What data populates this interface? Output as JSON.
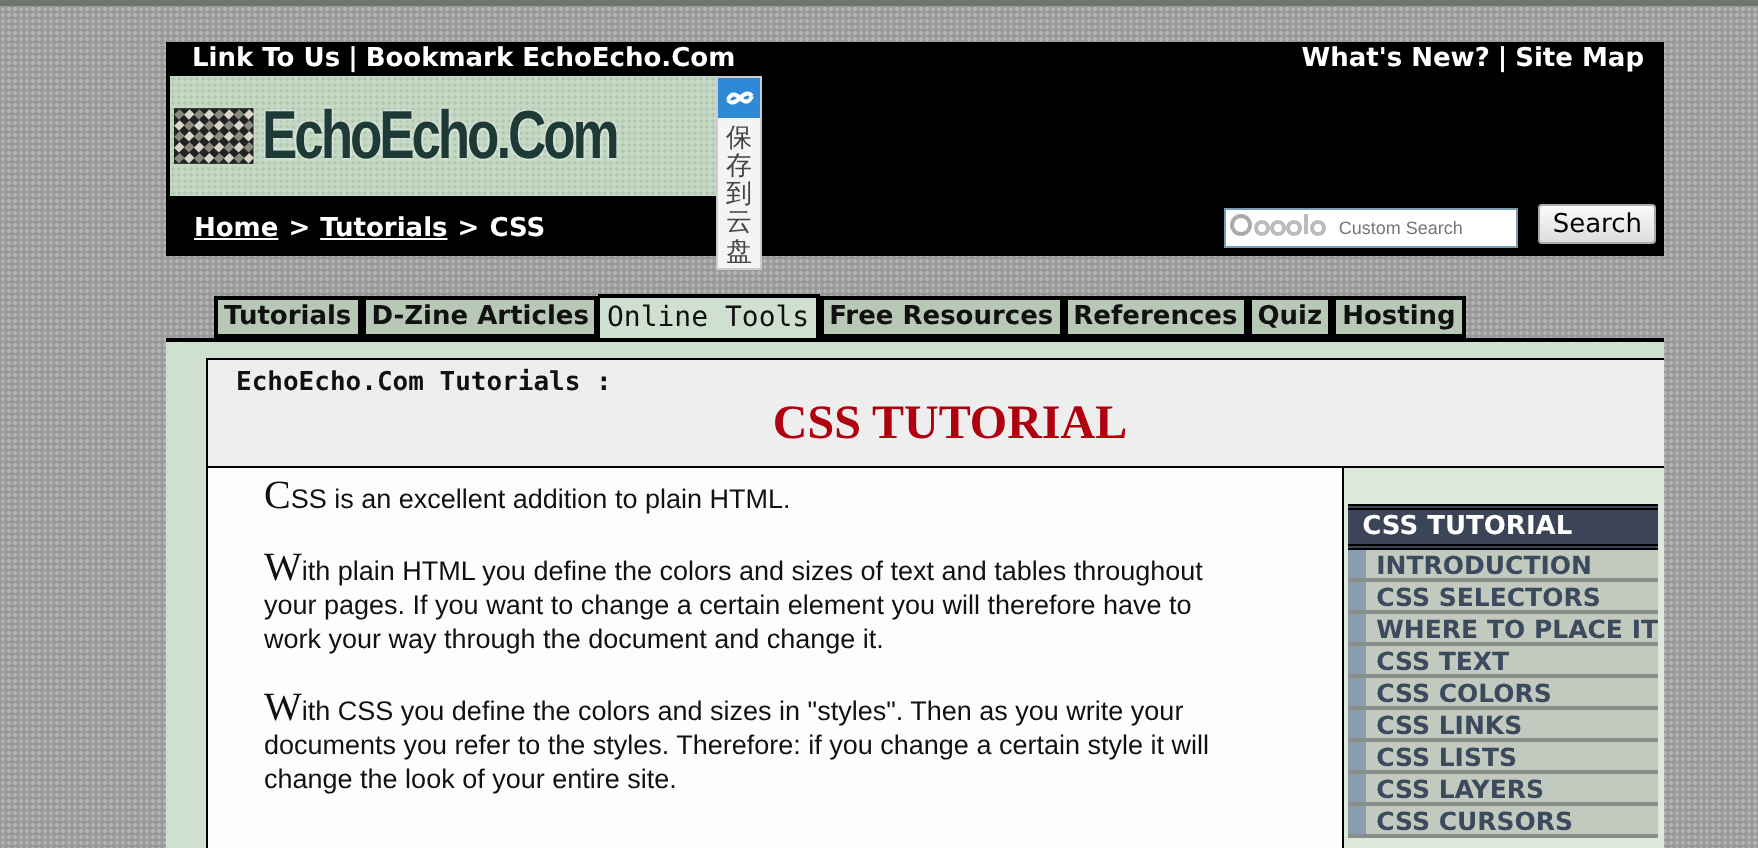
{
  "header": {
    "top_left_links": [
      "Link To Us",
      "Bookmark EchoEcho.Com"
    ],
    "link_separator": "|",
    "top_right_links": [
      "What's New?",
      "Site Map"
    ],
    "breadcrumb_separator": ">",
    "logo_text": "EchoEcho.Com",
    "cloud_save": "保存到云盘",
    "breadcrumb": [
      "Home",
      "Tutorials",
      "CSS"
    ],
    "search": {
      "placeholder": "Custom Search",
      "button": "Search"
    }
  },
  "tabs": [
    {
      "label": "Tutorials",
      "selected": false
    },
    {
      "label": "D-Zine Articles",
      "selected": false
    },
    {
      "label": "Online Tools",
      "selected": true
    },
    {
      "label": "Free Resources",
      "selected": false
    },
    {
      "label": "References",
      "selected": false
    },
    {
      "label": "Quiz",
      "selected": false
    },
    {
      "label": "Hosting",
      "selected": false
    }
  ],
  "content": {
    "subtitle": "EchoEcho.Com Tutorials :",
    "title": "CSS TUTORIAL",
    "paragraphs": [
      "CSS is an excellent addition to plain HTML.",
      "With plain HTML you define the colors and sizes of text and tables throughout your pages. If you want to change a certain element you will therefore have to work your way through the document and change it.",
      "With CSS you define the colors and sizes in \"styles\". Then as you write your documents you refer to the styles. Therefore: if you change a certain style it will change the look of your entire site."
    ]
  },
  "sidebar": {
    "heading": "CSS TUTORIAL",
    "items": [
      "INTRODUCTION",
      "CSS SELECTORS",
      "WHERE TO PLACE IT",
      "CSS TEXT",
      "CSS COLORS",
      "CSS LINKS",
      "CSS LISTS",
      "CSS LAYERS",
      "CSS CURSORS"
    ]
  }
}
